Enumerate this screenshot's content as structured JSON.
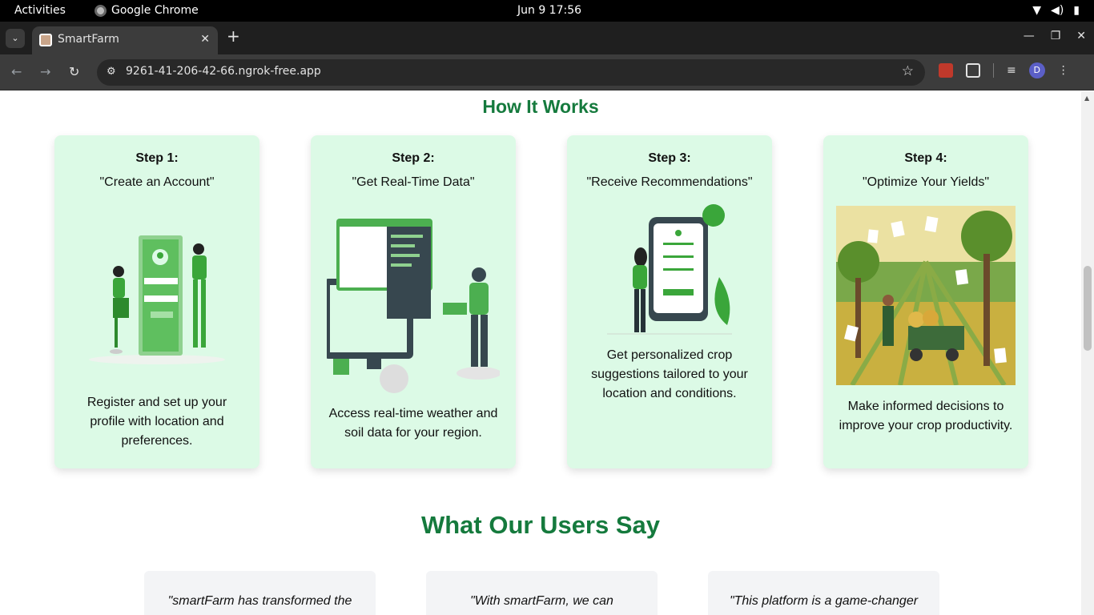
{
  "topbar": {
    "activities": "Activities",
    "app_name": "Google Chrome",
    "clock": "Jun 9  17:56"
  },
  "browser": {
    "tab_title": "SmartFarm",
    "url": "9261-41-206-42-66.ngrok-free.app",
    "profile_initial": "D"
  },
  "page": {
    "how_title": "How It Works",
    "steps": [
      {
        "step": "Step 1:",
        "subtitle": "\"Create an Account\"",
        "description": "Register and set up your profile with location and preferences."
      },
      {
        "step": "Step 2:",
        "subtitle": "\"Get Real-Time Data\"",
        "description": "Access real-time weather and soil data for your region."
      },
      {
        "step": "Step 3:",
        "subtitle": "\"Receive Recommendations\"",
        "description": "Get personalized crop suggestions tailored to your location and conditions."
      },
      {
        "step": "Step 4:",
        "subtitle": "\"Optimize Your Yields\"",
        "description": "Make informed decisions to improve your crop productivity."
      }
    ],
    "users_title": "What Our Users Say",
    "testimonials": [
      {
        "quote": "\"smartFarm has transformed the"
      },
      {
        "quote": "\"With smartFarm, we can"
      },
      {
        "quote": "\"This platform is a game-changer"
      }
    ]
  },
  "colors": {
    "heading_green": "#157a3d",
    "card_bg": "#dcfae6",
    "illustration_green": "#3aa63a"
  }
}
